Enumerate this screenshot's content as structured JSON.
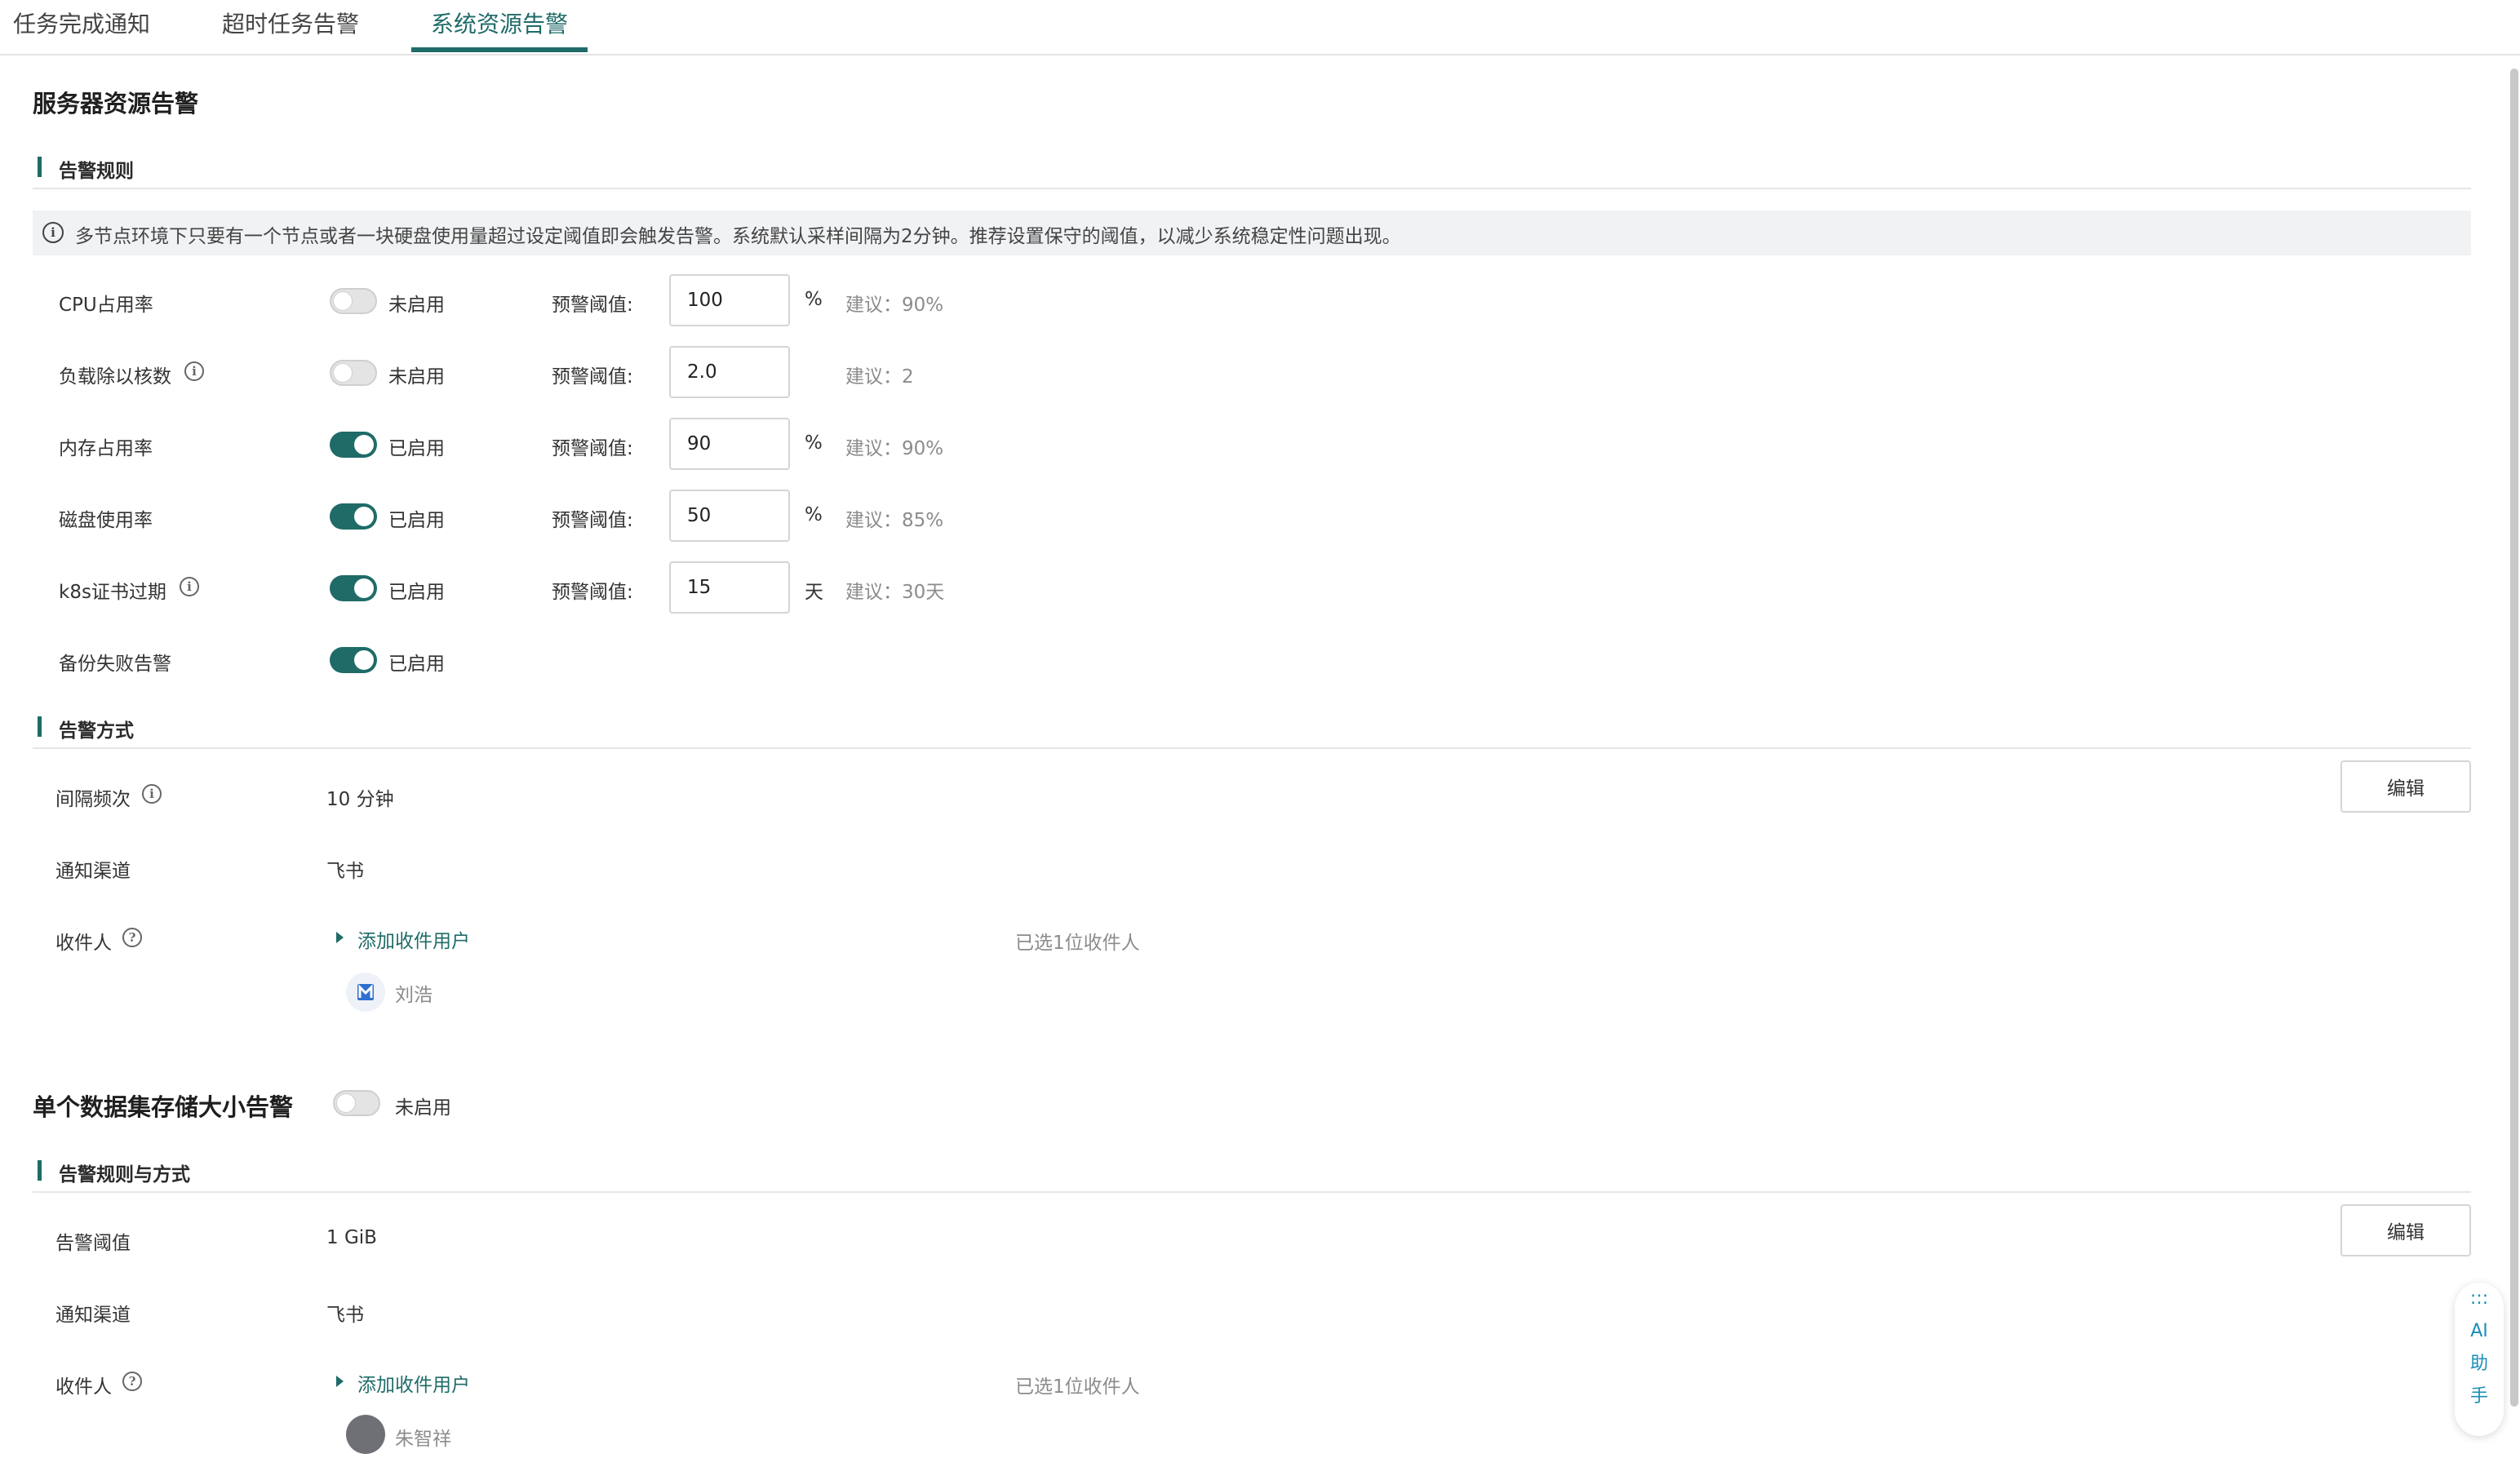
{
  "tabs": [
    {
      "label": "任务完成通知",
      "active": false
    },
    {
      "label": "超时任务告警",
      "active": false
    },
    {
      "label": "系统资源告警",
      "active": true
    }
  ],
  "server": {
    "title": "服务器资源告警",
    "rules_heading": "告警规则",
    "notice": "多节点环境下只要有一个节点或者一块硬盘使用量超过设定阈值即会触发告警。系统默认采样间隔为2分钟。推荐设置保守的阈值，以减少系统稳定性问题出现。",
    "threshold_label": "预警阈值:",
    "rules": [
      {
        "label": "CPU占用率",
        "enabled": false,
        "status": "未启用",
        "value": "100",
        "unit": "%",
        "suggest": "建议：90%"
      },
      {
        "label": "负载除以核数",
        "enabled": false,
        "status": "未启用",
        "value": "2.0",
        "unit": "",
        "suggest": "建议：2"
      },
      {
        "label": "内存占用率",
        "enabled": true,
        "status": "已启用",
        "value": "90",
        "unit": "%",
        "suggest": "建议：90%"
      },
      {
        "label": "磁盘使用率",
        "enabled": true,
        "status": "已启用",
        "value": "50",
        "unit": "%",
        "suggest": "建议：85%"
      },
      {
        "label": "k8s证书过期",
        "enabled": true,
        "status": "已启用",
        "value": "15",
        "unit": "天",
        "suggest": "建议：30天"
      },
      {
        "label": "备份失败告警",
        "enabled": true,
        "status": "已启用"
      }
    ],
    "method_heading": "告警方式",
    "edit_label": "编辑",
    "interval_label": "间隔频次",
    "interval_value": "10 分钟",
    "channel_label": "通知渠道",
    "channel_value": "飞书",
    "recipient_label": "收件人",
    "add_user": "添加收件用户",
    "selected_count": "已选1位收件人",
    "recipient_name": "刘浩"
  },
  "dataset": {
    "title": "单个数据集存储大小告警",
    "enabled": false,
    "status": "未启用",
    "heading": "告警规则与方式",
    "edit_label": "编辑",
    "threshold_label": "告警阈值",
    "threshold_value": "1 GiB",
    "channel_label": "通知渠道",
    "channel_value": "飞书",
    "recipient_label": "收件人",
    "add_user": "添加收件用户",
    "selected_count": "已选1位收件人",
    "recipient_name": "朱智祥"
  },
  "ai_assistant": {
    "icon": ":::",
    "chars": [
      "AI",
      "助",
      "手"
    ]
  },
  "colors": {
    "accent": "#1f6b68",
    "notice_bg": "#f1f2f4",
    "ai_text": "#1a8fb8"
  }
}
